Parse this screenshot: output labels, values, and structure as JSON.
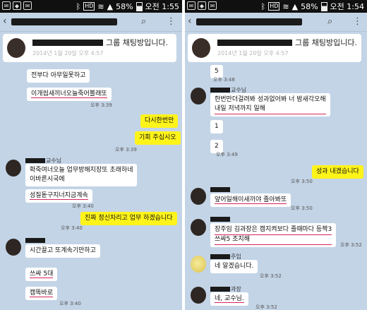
{
  "left": {
    "status": {
      "battery": "58%",
      "time": "오전 1:55"
    },
    "notice": {
      "title": "그룹 채팅방입니다.",
      "date": "2014년 1월 20일 오후 4:57"
    },
    "messages": [
      {
        "text": "전부다 아무일못하고",
        "time": ""
      },
      {
        "text": "이개씹새끼너오늘죽어볼래또",
        "time": "오후 3:39"
      },
      {
        "text": "다시한번만",
        "time": ""
      },
      {
        "text": "기회 주십시오",
        "time": "오후 3:39"
      },
      {
        "sender": "교수님",
        "lines": [
          "확죽여너오늘 업무방해지장또 초래하네",
          "이바른시국에"
        ],
        "time": ""
      },
      {
        "text": "성질돋구지너지금계속",
        "time": "오후 3:40"
      },
      {
        "text": "진짜 정신차리고 업무 하겠습니다",
        "time": "오후 3:40"
      },
      {
        "lines": [
          "시간끌고 또계속기만하고"
        ],
        "time": ""
      },
      {
        "text": "쓰싸 5대",
        "time": ""
      },
      {
        "text": "캠똑바로",
        "time": "오후 3:40"
      }
    ]
  },
  "right": {
    "status": {
      "battery": "58%",
      "time": "오전 1:54"
    },
    "notice": {
      "title": "그룹 채팅방입니다.",
      "date": "2014년 1월 20일 오후 4:57"
    },
    "messages": [
      {
        "text": "5",
        "time": "오후 3:48"
      },
      {
        "sender": "교수님",
        "lines": [
          "한번만더걸려봐 성과없어봐 너 밤새각오해",
          "내일 저녁까지 일해"
        ],
        "time": ""
      },
      {
        "text": "1",
        "time": ""
      },
      {
        "text": "2",
        "time": "오후 3:49"
      },
      {
        "text": "성과 내겠습니다",
        "time": "오후 3:50"
      },
      {
        "text": "앞어일해이새끼야 졸아봐또",
        "time": "오후 3:50"
      },
      {
        "lines": [
          "장주임 김과장은 캠지켜보다 졸때마다 등짝3",
          "쓰싸5 조지해"
        ],
        "time": "오후 3:52"
      },
      {
        "sender": "주임",
        "text": "네 알겠습니다.",
        "time": "오후 3:52"
      },
      {
        "sender": "과장",
        "text": "네, 교수님.",
        "time": "오후 3:52"
      }
    ]
  },
  "icons": {
    "back": "back-arrow-icon",
    "search": "search-icon",
    "menu": "more-vert-icon"
  }
}
